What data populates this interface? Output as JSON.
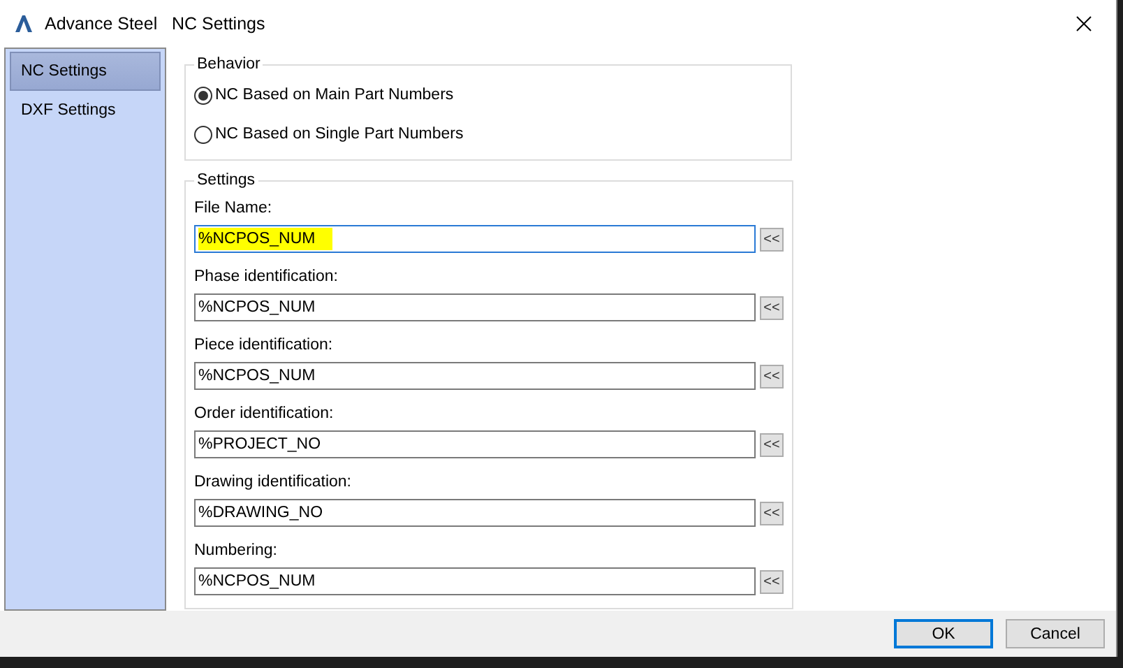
{
  "window": {
    "title": "Advance Steel   NC Settings"
  },
  "sidebar": {
    "items": [
      {
        "label": "NC Settings",
        "selected": true
      },
      {
        "label": "DXF Settings",
        "selected": false
      }
    ]
  },
  "behavior": {
    "title": "Behavior",
    "options": [
      {
        "label": "NC Based on Main Part Numbers",
        "selected": true
      },
      {
        "label": "NC Based on Single Part Numbers",
        "selected": false
      }
    ]
  },
  "settings": {
    "title": "Settings",
    "fields": [
      {
        "label": "File Name:",
        "value": "%NCPOS_NUM",
        "highlighted": true,
        "button": "<<"
      },
      {
        "label": "Phase identification:",
        "value": "%NCPOS_NUM",
        "highlighted": false,
        "button": "<<"
      },
      {
        "label": "Piece identification:",
        "value": "%NCPOS_NUM",
        "highlighted": false,
        "button": "<<"
      },
      {
        "label": "Order identification:",
        "value": "%PROJECT_NO",
        "highlighted": false,
        "button": "<<"
      },
      {
        "label": "Drawing identification:",
        "value": "%DRAWING_NO",
        "highlighted": false,
        "button": "<<"
      },
      {
        "label": "Numbering:",
        "value": "%NCPOS_NUM",
        "highlighted": false,
        "button": "<<"
      }
    ]
  },
  "buttons": [
    {
      "label": "OK",
      "kind": "default"
    },
    {
      "label": "Cancel",
      "kind": "normal"
    }
  ]
}
